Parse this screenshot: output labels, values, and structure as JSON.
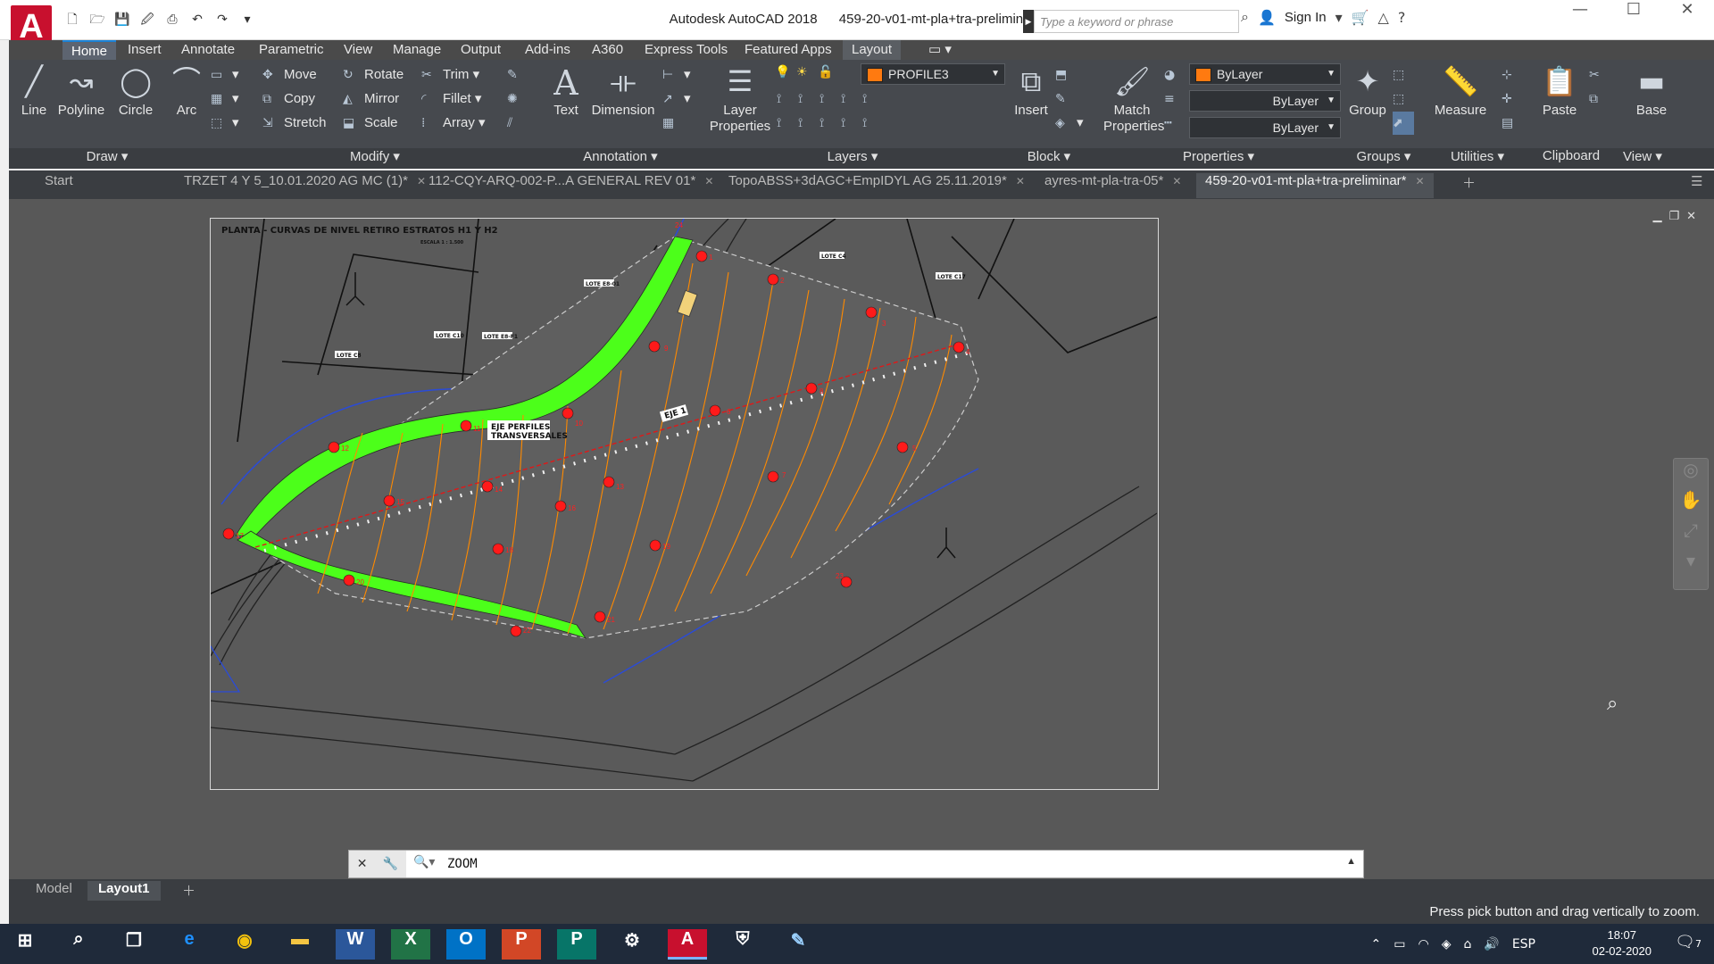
{
  "app": {
    "logo": "A",
    "name": "Autodesk AutoCAD 2018",
    "file": "459-20-v01-mt-pla+tra-preliminar.dwg"
  },
  "search": {
    "placeholder": "Type a keyword or phrase"
  },
  "account": {
    "sign_in": "Sign In"
  },
  "qat_icons": [
    "new-icon",
    "open-icon",
    "save-icon",
    "saveas-icon",
    "print-icon",
    "undo-icon",
    "redo-icon"
  ],
  "ribbon_tabs": [
    "Home",
    "Insert",
    "Annotate",
    "Parametric",
    "View",
    "Manage",
    "Output",
    "Add-ins",
    "A360",
    "Express Tools",
    "Featured Apps",
    "Layout"
  ],
  "ribbon": {
    "draw": {
      "line": "Line",
      "polyline": "Polyline",
      "circle": "Circle",
      "arc": "Arc",
      "title": "Draw"
    },
    "modify": {
      "move": "Move",
      "rotate": "Rotate",
      "trim": "Trim",
      "copy": "Copy",
      "mirror": "Mirror",
      "fillet": "Fillet",
      "stretch": "Stretch",
      "scale": "Scale",
      "array": "Array",
      "title": "Modify"
    },
    "annotation": {
      "text": "Text",
      "dimension": "Dimension",
      "title": "Annotation"
    },
    "layers": {
      "props": "Layer Properties",
      "layer_name": "PROFILE3",
      "title": "Layers"
    },
    "block": {
      "insert": "Insert",
      "title": "Block"
    },
    "properties": {
      "match": "Match Properties",
      "color": "ByLayer",
      "linetype": "ByLayer",
      "lineweight": "ByLayer",
      "title": "Properties"
    },
    "groups": {
      "group": "Group",
      "title": "Groups"
    },
    "utilities": {
      "measure": "Measure",
      "title": "Utilities"
    },
    "clipboard": {
      "paste": "Paste",
      "title": "Clipboard"
    },
    "view": {
      "base": "Base",
      "title": "View"
    }
  },
  "doc_tabs": [
    "Start",
    "TRZET 4 Y 5_10.01.2020 AG MC (1)*",
    "112-CQY-ARQ-002-P...A GENERAL REV 01*",
    "TopoABSS+3dAGC+EmpIDYL AG 25.11.2019*",
    "ayres-mt-pla-tra-05*",
    "459-20-v01-mt-pla+tra-preliminar*"
  ],
  "drawing": {
    "title": "PLANTA - CURVAS DE NIVEL RETIRO ESTRATOS H1 Y H2",
    "scale": "ESCALA 1 : 1.500",
    "axis_label": "EJE 1",
    "section_label_1": "EJE PERFILES",
    "section_label_2": "TRANSVERSALES",
    "lots": [
      "LOTE C4",
      "LOTE C17",
      "LOTE E8-01",
      "LOTE C10",
      "LOTE E8-F1",
      "LOTE C8"
    ],
    "points": [
      "1",
      "2",
      "3",
      "4",
      "5",
      "6",
      "7",
      "8",
      "9",
      "10",
      "11",
      "12",
      "13",
      "14",
      "15",
      "16",
      "17",
      "18",
      "19",
      "20",
      "21",
      "22",
      "23",
      "24"
    ]
  },
  "command": {
    "text": "ZOOM"
  },
  "layout_tabs": [
    "Model",
    "Layout1"
  ],
  "status": {
    "message": "Press pick button and drag vertically to zoom."
  },
  "taskbar": {
    "lang": "ESP",
    "time": "18:07",
    "date": "02-02-2020",
    "notifications": "7"
  },
  "colors": {
    "accent": "#1b82d6",
    "brand": "#c8102e",
    "ribbon": "#46494e",
    "canvas": "#585858",
    "green_band": "#4cff1a",
    "contour": "#ff8a00",
    "marker": "#ff1a1a"
  }
}
